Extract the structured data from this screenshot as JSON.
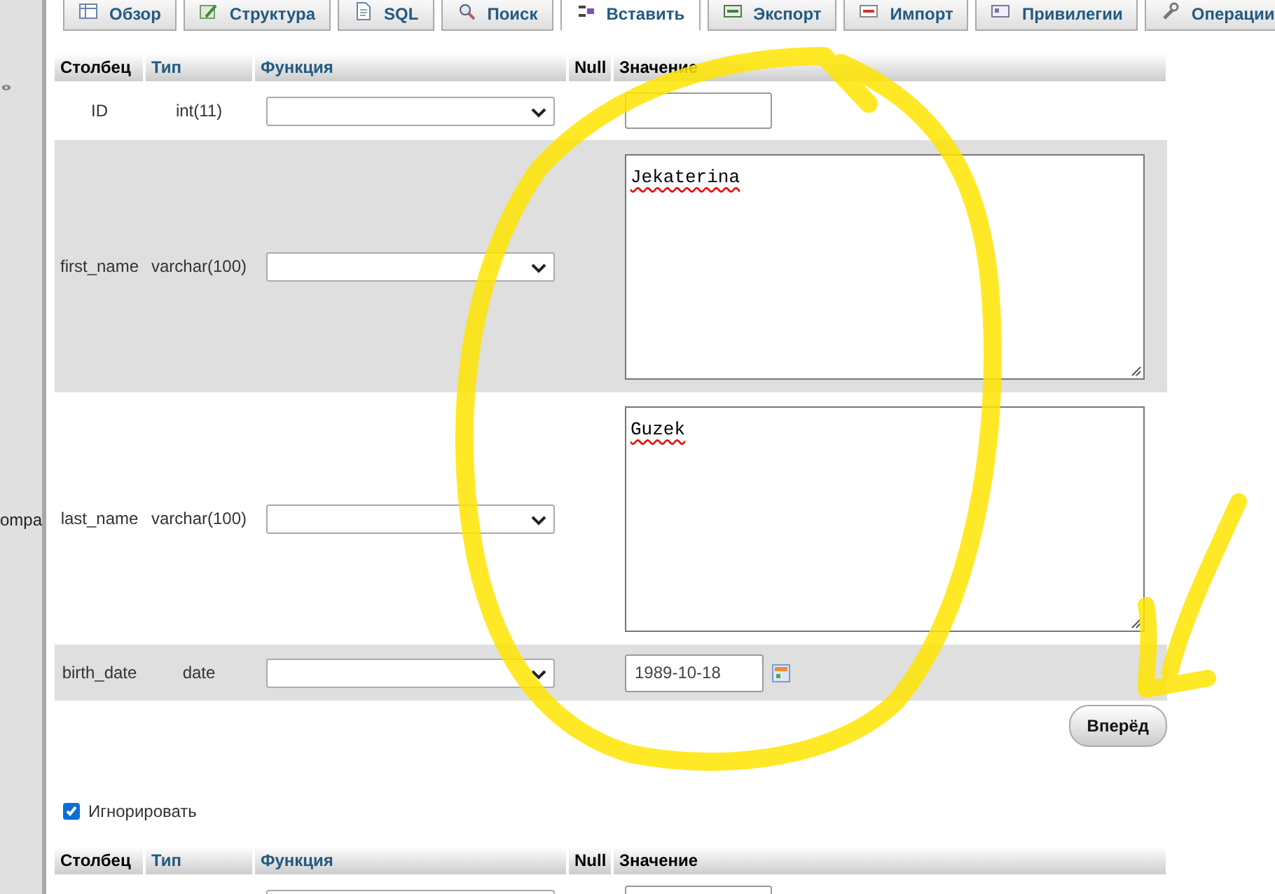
{
  "sidebar": {
    "cut_text": "ompa"
  },
  "tabs": [
    {
      "label": "Обзор",
      "selected": false
    },
    {
      "label": "Структура",
      "selected": false
    },
    {
      "label": "SQL",
      "selected": false
    },
    {
      "label": "Поиск",
      "selected": false
    },
    {
      "label": "Вставить",
      "selected": true
    },
    {
      "label": "Экспорт",
      "selected": false
    },
    {
      "label": "Импорт",
      "selected": false
    },
    {
      "label": "Привилегии",
      "selected": false
    },
    {
      "label": "Операции",
      "selected": false
    }
  ],
  "insert_form": {
    "columns": [
      "Столбец",
      "Тип",
      "Функция",
      "Null",
      "Значение"
    ],
    "rows": [
      {
        "column": "ID",
        "type": "int(11)",
        "kind": "input"
      },
      {
        "column": "first_name",
        "type": "varchar(100)",
        "kind": "textarea",
        "value": "Jekaterina",
        "misspelled": true
      },
      {
        "column": "last_name",
        "type": "varchar(100)",
        "kind": "textarea",
        "value": "Guzek",
        "misspelled": true
      },
      {
        "column": "birth_date",
        "type": "date",
        "kind": "date",
        "value": "1989-10-18"
      }
    ],
    "submit": "Вперёд"
  },
  "ignore": {
    "label": "Игнорировать",
    "checked": true
  },
  "second_form": {
    "columns": [
      "Столбец",
      "Тип",
      "Функция",
      "Null",
      "Значение"
    ],
    "rows": [
      {
        "kind": "input"
      }
    ]
  }
}
